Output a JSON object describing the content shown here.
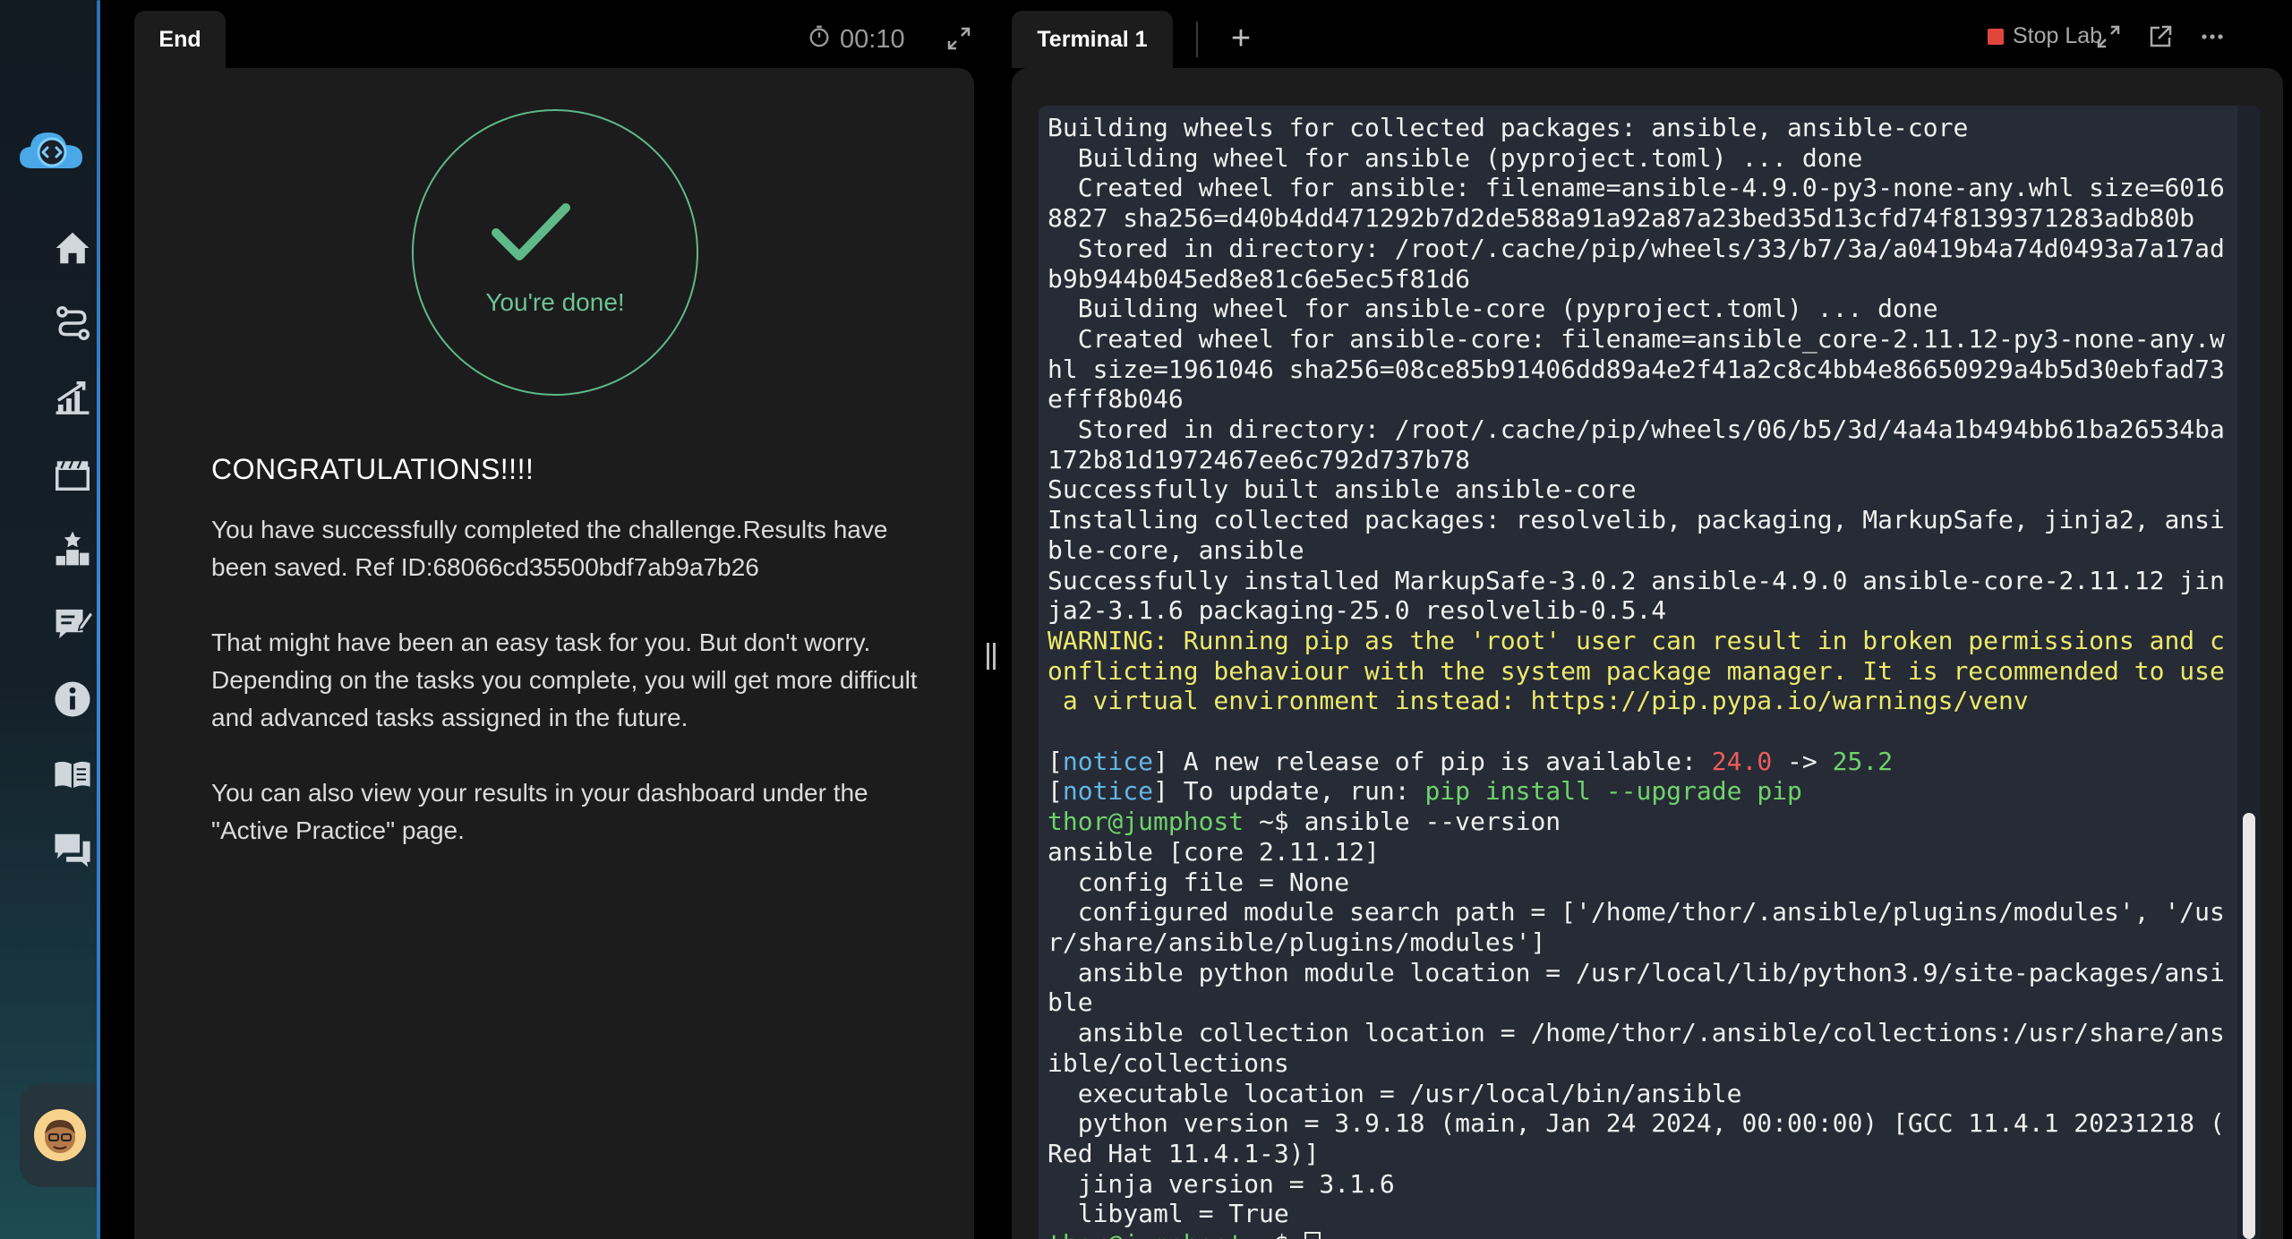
{
  "sidebar": {
    "logo_icon": "cloud-code-icon",
    "items": [
      {
        "icon": "home-icon"
      },
      {
        "icon": "route-icon"
      },
      {
        "icon": "progress-chart-icon"
      },
      {
        "icon": "clapperboard-icon"
      },
      {
        "icon": "leaderboard-icon"
      },
      {
        "icon": "feedback-icon"
      },
      {
        "icon": "info-icon"
      },
      {
        "icon": "book-icon"
      },
      {
        "icon": "chat-icon"
      }
    ],
    "avatar_icon": "user-avatar"
  },
  "left_panel": {
    "tab_label": "End",
    "timer": "00:10",
    "done_text": "You're done!",
    "heading": "CONGRATULATIONS!!!!",
    "paragraphs": [
      "You have successfully completed the challenge.Results have been saved. Ref ID:68066cd35500bdf7ab9a7b26",
      "That might have been an easy task for you. But don't worry. Depending on the tasks you complete, you will get more difficult and advanced tasks assigned in the future.",
      "You can also view your results in your dashboard under the \"Active Practice\" page."
    ]
  },
  "right_panel": {
    "tab_label": "Terminal 1",
    "add_tab_label": "+",
    "stop_label": "Stop Lab",
    "colors": {
      "accent_green": "#6cc497",
      "stop_red": "#e0463c",
      "warning_yellow": "#ecea6c"
    },
    "terminal": {
      "lines_before_warning": [
        "Building wheels for collected packages: ansible, ansible-core",
        "  Building wheel for ansible (pyproject.toml) ... done",
        "  Created wheel for ansible: filename=ansible-4.9.0-py3-none-any.whl size=6016",
        "8827 sha256=d40b4dd471292b7d2de588a91a92a87a23bed35d13cfd74f8139371283adb80b",
        "  Stored in directory: /root/.cache/pip/wheels/33/b7/3a/a0419b4a74d0493a7a17ad",
        "b9b944b045ed8e81c6e5ec5f81d6",
        "  Building wheel for ansible-core (pyproject.toml) ... done",
        "  Created wheel for ansible-core: filename=ansible_core-2.11.12-py3-none-any.w",
        "hl size=1961046 sha256=08ce85b91406dd89a4e2f41a2c8c4bb4e86650929a4b5d30ebfad73",
        "efff8b046",
        "  Stored in directory: /root/.cache/pip/wheels/06/b5/3d/4a4a1b494bb61ba26534ba",
        "172b81d1972467ee6c792d737b78",
        "Successfully built ansible ansible-core",
        "Installing collected packages: resolvelib, packaging, MarkupSafe, jinja2, ansi",
        "ble-core, ansible",
        "Successfully installed MarkupSafe-3.0.2 ansible-4.9.0 ansible-core-2.11.12 jin",
        "ja2-3.1.6 packaging-25.0 resolvelib-0.5.4"
      ],
      "warning_lines": [
        "WARNING: Running pip as the 'root' user can result in broken permissions and c",
        "onflicting behaviour with the system package manager. It is recommended to use",
        " a virtual environment instead: https://pip.pypa.io/warnings/venv"
      ],
      "notice_tag": "notice",
      "notice1_text": " A new release of pip is available: ",
      "notice1_old": "24.0",
      "notice1_arrow": " -> ",
      "notice1_new": "25.2",
      "notice2_text": " To update, run: ",
      "notice2_cmd": "pip install --upgrade pip",
      "prompt_user": "thor@jumphost",
      "prompt_path": " ~$",
      "command": " ansible --version",
      "output_lines": [
        "ansible [core 2.11.12]",
        "  config file = None",
        "  configured module search path = ['/home/thor/.ansible/plugins/modules', '/us",
        "r/share/ansible/plugins/modules']",
        "  ansible python module location = /usr/local/lib/python3.9/site-packages/ansi",
        "ble",
        "  ansible collection location = /home/thor/.ansible/collections:/usr/share/ans",
        "ible/collections",
        "  executable location = /usr/local/bin/ansible",
        "  python version = 3.9.18 (main, Jan 24 2024, 00:00:00) [GCC 11.4.1 20231218 (",
        "Red Hat 11.4.1-3)]",
        "  jinja version = 3.1.6",
        "  libyaml = True"
      ]
    }
  }
}
